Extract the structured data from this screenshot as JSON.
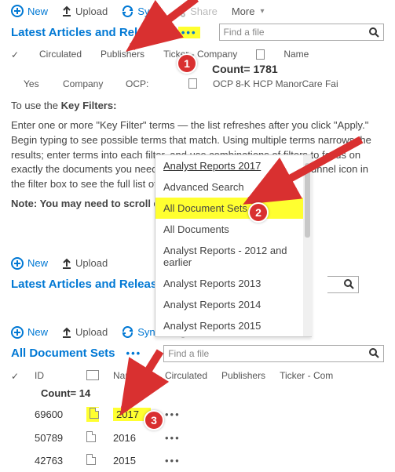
{
  "toolbar": {
    "new_label": "New",
    "upload_label": "Upload",
    "sync_label": "Sync",
    "share_label": "Share",
    "more_label": "More"
  },
  "section1": {
    "view_title": "Latest Articles and Releases",
    "find_placeholder": "Find a file",
    "cols": {
      "circulated": "Circulated",
      "publishers": "Publishers",
      "ticker": "Ticker - Company",
      "name": "Name"
    },
    "count_label": "Count= 1781",
    "row": {
      "c1": "Yes",
      "c2": "Company",
      "c3": "OCP:",
      "c4": "OCP 8-K HCP ManorCare Fai"
    }
  },
  "guide": {
    "p1a": "To use the ",
    "p1b": "Key Filters:",
    "p2": "Enter one or more \"Key Filter\" terms — the list refreshes after you click \"Apply.\"  Begin typing to see possible terms that match. Using multiple terms narrows the results; enter terms into each filter, and use combinations of filters to focus on exactly the documents you need. Alternately, you can click on the funnel icon in the filter box to see the full list of available terms.",
    "p3": "Note: You may need to scroll down to see results."
  },
  "menu": {
    "items": [
      "Analyst Reports 2017",
      "Advanced Search",
      "All Document Sets",
      "All Documents",
      "Analyst Reports - 2012 and earlier",
      "Analyst Reports 2013",
      "Analyst Reports 2014",
      "Analyst Reports 2015"
    ]
  },
  "section2": {
    "view_title": "All Document Sets",
    "find_placeholder": "Find a file",
    "cols": {
      "id": "ID",
      "name": "Name",
      "circulated": "Circulated",
      "publishers": "Publishers",
      "ticker": "Ticker - Com"
    },
    "count_label": "Count= 14",
    "rows": [
      {
        "id": "69600",
        "name": "2017"
      },
      {
        "id": "50789",
        "name": "2016"
      },
      {
        "id": "42763",
        "name": "2015"
      }
    ]
  },
  "callouts": {
    "c1": "1",
    "c2": "2",
    "c3": "3"
  }
}
